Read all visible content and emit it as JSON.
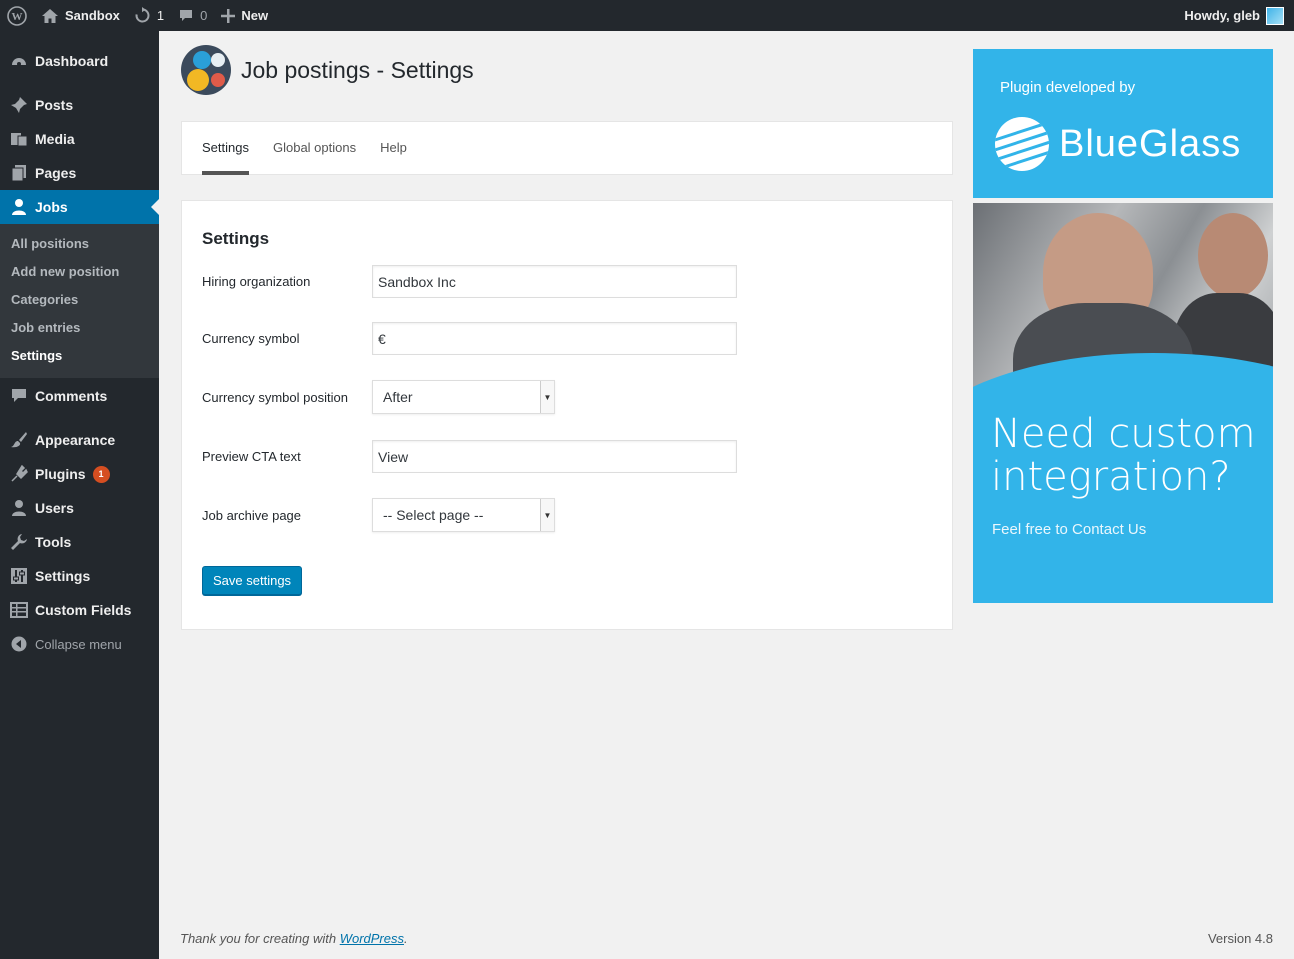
{
  "adminbar": {
    "site_name": "Sandbox",
    "updates_count": "1",
    "comments_count": "0",
    "new_label": "New",
    "howdy": "Howdy, gleb"
  },
  "sidebar": {
    "items": [
      {
        "label": "Dashboard"
      },
      {
        "label": "Posts"
      },
      {
        "label": "Media"
      },
      {
        "label": "Pages"
      },
      {
        "label": "Jobs"
      },
      {
        "label": "Comments"
      },
      {
        "label": "Appearance"
      },
      {
        "label": "Plugins",
        "badge": "1"
      },
      {
        "label": "Users"
      },
      {
        "label": "Tools"
      },
      {
        "label": "Settings"
      },
      {
        "label": "Custom Fields"
      },
      {
        "label": "Collapse menu"
      }
    ],
    "jobs_submenu": [
      "All positions",
      "Add new position",
      "Categories",
      "Job entries",
      "Settings"
    ]
  },
  "page": {
    "title": "Job postings - Settings",
    "tabs": [
      "Settings",
      "Global options",
      "Help"
    ]
  },
  "form": {
    "heading": "Settings",
    "fields": [
      {
        "label": "Hiring organization",
        "value": "Sandbox Inc"
      },
      {
        "label": "Currency symbol",
        "value": "€"
      },
      {
        "label": "Currency symbol position",
        "value": "After"
      },
      {
        "label": "Preview CTA text",
        "value": "View"
      },
      {
        "label": "Job archive page",
        "value": "-- Select page --"
      }
    ],
    "save_label": "Save settings"
  },
  "ad": {
    "developed_by": "Plugin developed by",
    "brand": "BlueGlass",
    "headline": "Need custom integration?",
    "cta": "Feel free to Contact Us"
  },
  "footer": {
    "thanks_prefix": "Thank you for creating with",
    "link": "WordPress",
    "suffix": ".",
    "version": "Version 4.8"
  }
}
